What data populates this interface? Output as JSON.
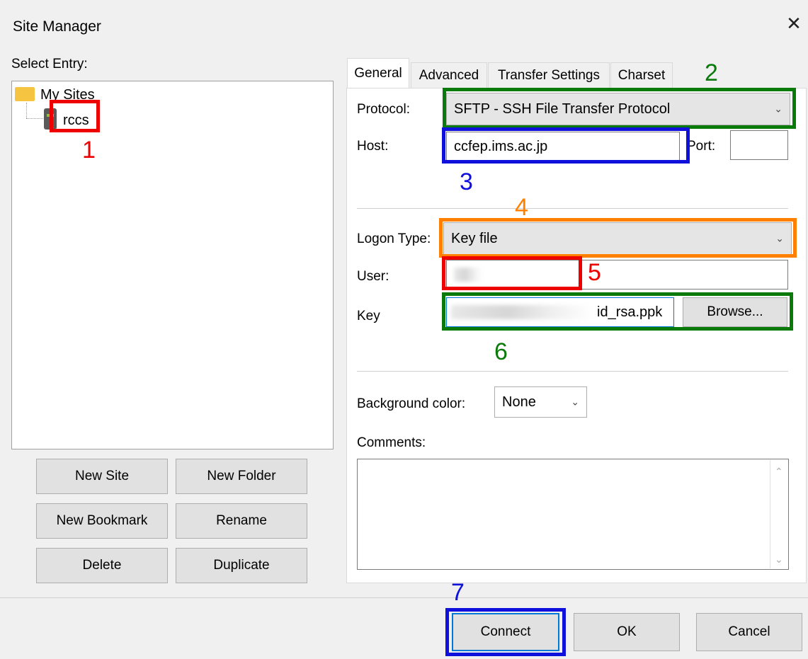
{
  "window": {
    "title": "Site Manager",
    "close_glyph": "✕"
  },
  "tree": {
    "label": "Select Entry:",
    "root": {
      "label": "My Sites",
      "icon": "folder-icon"
    },
    "child": {
      "label": "rccs",
      "icon": "server-icon"
    }
  },
  "site_buttons": {
    "new_site": "New Site",
    "new_folder": "New Folder",
    "new_bookmark": "New Bookmark",
    "rename": "Rename",
    "delete": "Delete",
    "duplicate": "Duplicate"
  },
  "tabs": [
    "General",
    "Advanced",
    "Transfer Settings",
    "Charset"
  ],
  "general": {
    "protocol_label": "Protocol:",
    "protocol_value": "SFTP - SSH File Transfer Protocol",
    "host_label": "Host:",
    "host_value": "ccfep.ims.ac.jp",
    "port_label": "Port:",
    "port_value": "",
    "logon_type_label": "Logon Type:",
    "logon_type_value": "Key file",
    "user_label": "User:",
    "key_label": "Key",
    "key_value_suffix": "id_rsa.ppk",
    "browse_label": "Browse...",
    "bg_color_label": "Background color:",
    "bg_color_value": "None",
    "comments_label": "Comments:",
    "comments_value": ""
  },
  "footer": {
    "connect": "Connect",
    "ok": "OK",
    "cancel": "Cancel"
  },
  "annotations": {
    "n1": "1",
    "n2": "2",
    "n3": "3",
    "n4": "4",
    "n5": "5",
    "n6": "6",
    "n7": "7"
  },
  "colors": {
    "red": "#ee0000",
    "green": "#0a7a0a",
    "blue": "#1010dd",
    "orange": "#ff8000"
  }
}
